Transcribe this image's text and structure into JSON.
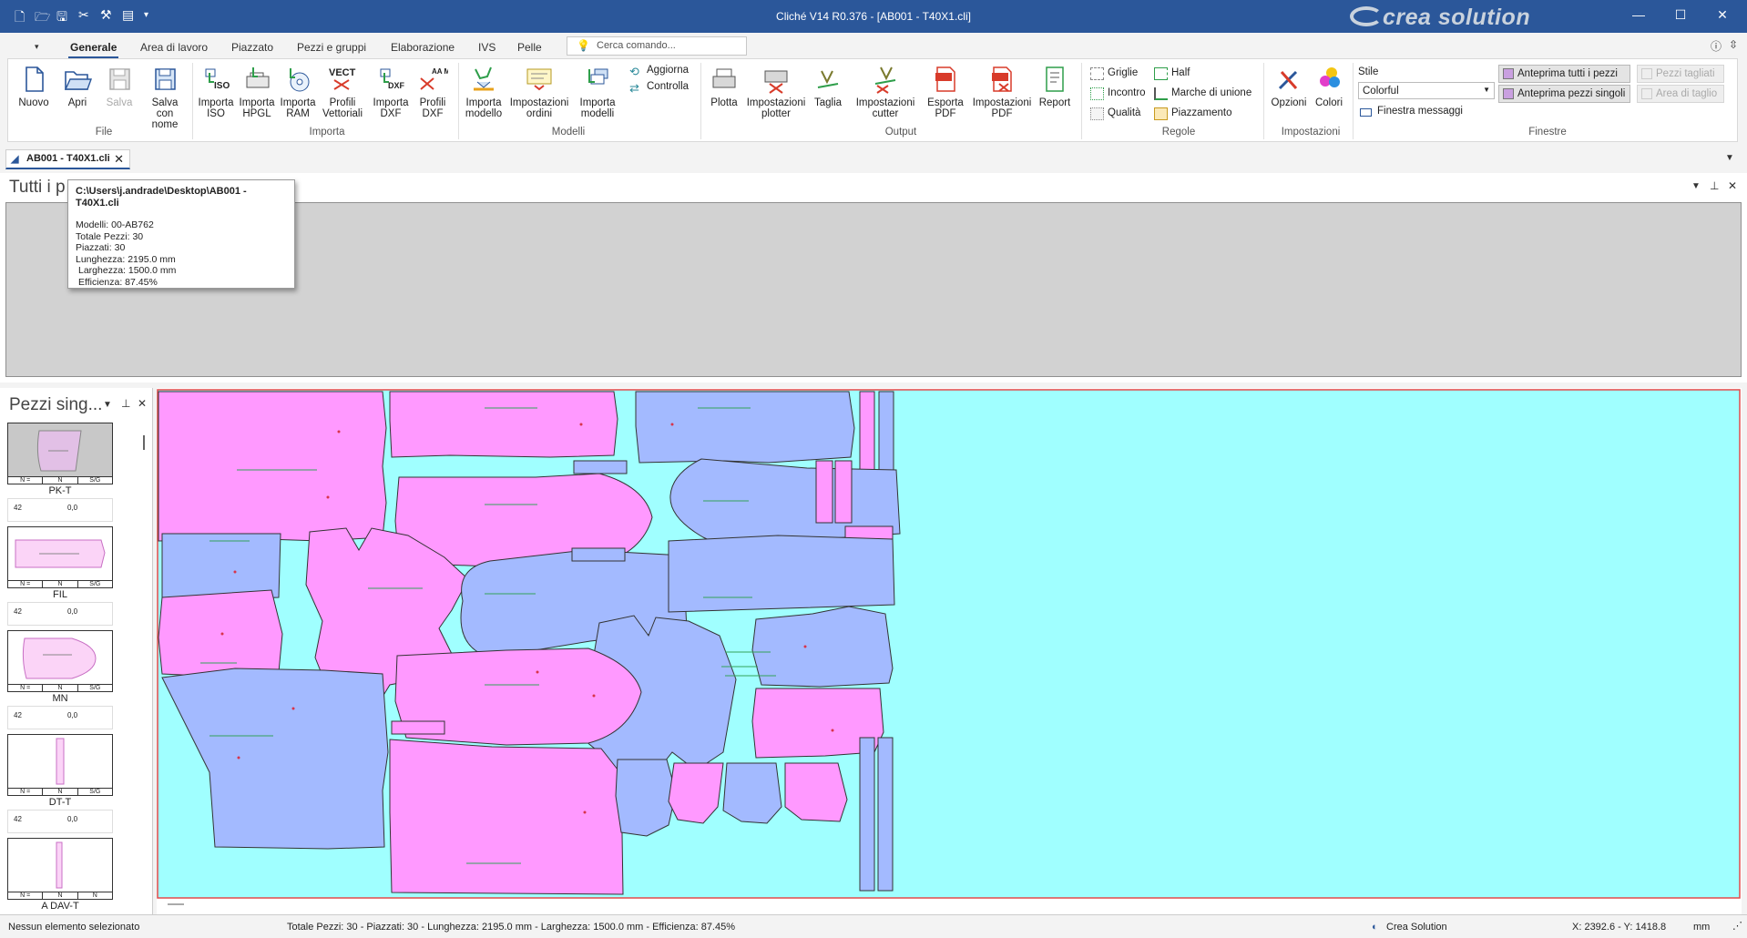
{
  "titlebar": {
    "title": "Cliché V14 R0.376 - [AB001 - T40X1.cli]",
    "brand": "crea solution",
    "quick_access": [
      "new-doc-icon",
      "open-icon",
      "save-icon",
      "scissors-icon",
      "tools-icon",
      "print-preview-icon",
      "customize-icon"
    ]
  },
  "ribbon_tabs": [
    "Generale",
    "Area di lavoro",
    "Piazzato",
    "Pezzi e gruppi",
    "Elaborazione",
    "IVS",
    "Pelle"
  ],
  "search": {
    "placeholder": "Cerca comando..."
  },
  "ribbon": {
    "file": {
      "label": "File",
      "nuovo": "Nuovo",
      "apri": "Apri",
      "salva": "Salva",
      "salva_con_nome": "Salva con nome"
    },
    "importa": {
      "label": "Importa",
      "iso": "Importa ISO",
      "hpgl": "Importa HPGL",
      "ram": "Importa RAM",
      "vect": "Profili Vettoriali",
      "dxf": "Importa DXF",
      "pdxf": "Profili DXF",
      "iso_text": "ISO",
      "vect_text": "VECT",
      "dxf_text": "DXF",
      "aama_text": "AA MA"
    },
    "modelli": {
      "label": "Modelli",
      "modello": "Importa modello",
      "ordini": "Impostazioni ordini",
      "modelli": "Importa modelli",
      "aggiorna": "Aggiorna",
      "controlla": "Controlla"
    },
    "output": {
      "label": "Output",
      "plotta": "Plotta",
      "imp_plotter": "Impostazioni plotter",
      "taglia": "Taglia",
      "imp_cutter": "Impostazioni cutter",
      "esporta_pdf": "Esporta PDF",
      "imp_pdf": "Impostazioni PDF",
      "report": "Report"
    },
    "regole": {
      "label": "Regole",
      "griglie": "Griglie",
      "incontro": "Incontro",
      "qualita": "Qualità",
      "half": "Half",
      "marche": "Marche di unione",
      "piazzamento": "Piazzamento"
    },
    "impostazioni": {
      "label": "Impostazioni",
      "opzioni": "Opzioni",
      "colori": "Colori"
    },
    "finestre": {
      "label": "Finestre",
      "stile_label": "Stile",
      "stile_value": "Colorful",
      "messaggi": "Finestra messaggi",
      "anteprima_tutti": "Anteprima tutti i pezzi",
      "anteprima_singoli": "Anteprima pezzi singoli",
      "pezzi_tagliati": "Pezzi tagliati",
      "area_taglio": "Area di taglio"
    }
  },
  "doc_tab": {
    "label": "AB001 - T40X1.cli"
  },
  "top_pane": {
    "title": "Tutti i p"
  },
  "tooltip": {
    "path": "C:\\Users\\j.andrade\\Desktop\\AB001 - T40X1.cli",
    "lines": [
      "Modelli: 00-AB762",
      "Totale Pezzi: 30",
      "Piazzati: 30",
      "Lunghezza: 2195.0 mm",
      "Larghezza: 1500.0 mm",
      "Efficienza: 87.45%"
    ]
  },
  "left_panel": {
    "title": "Pezzi sing...",
    "pieces": [
      {
        "name": "PK-T",
        "size": "42",
        "value": "0,0",
        "cols": [
          "N =",
          "N",
          "S/G"
        ]
      },
      {
        "name": "FIL",
        "size": "42",
        "value": "0,0",
        "cols": [
          "N =",
          "N",
          "S/G"
        ]
      },
      {
        "name": "MN",
        "size": "42",
        "value": "0,0",
        "cols": [
          "N =",
          "N",
          "S/G"
        ]
      },
      {
        "name": "DT-T",
        "size": "42",
        "value": "0,0",
        "cols": [
          "N =",
          "N",
          "S/G"
        ]
      },
      {
        "name": "A DAV-T",
        "size": "",
        "value": "",
        "cols": [
          "N =",
          "N",
          "N"
        ]
      }
    ]
  },
  "colors": {
    "pink": "#ff99ff",
    "blue": "#a3baff",
    "background": "#a0ffff",
    "border": "#e24a4a",
    "title_bar": "#2b579a"
  },
  "statusbar": {
    "selection": "Nessun elemento selezionato",
    "summary": "Totale Pezzi: 30 - Piazzati: 30 - Lunghezza: 2195.0 mm - Larghezza: 1500.0 mm - Efficienza: 87.45%",
    "brand": "Crea Solution",
    "coords": "X: 2392.6 - Y: 1418.8",
    "unit": "mm"
  }
}
